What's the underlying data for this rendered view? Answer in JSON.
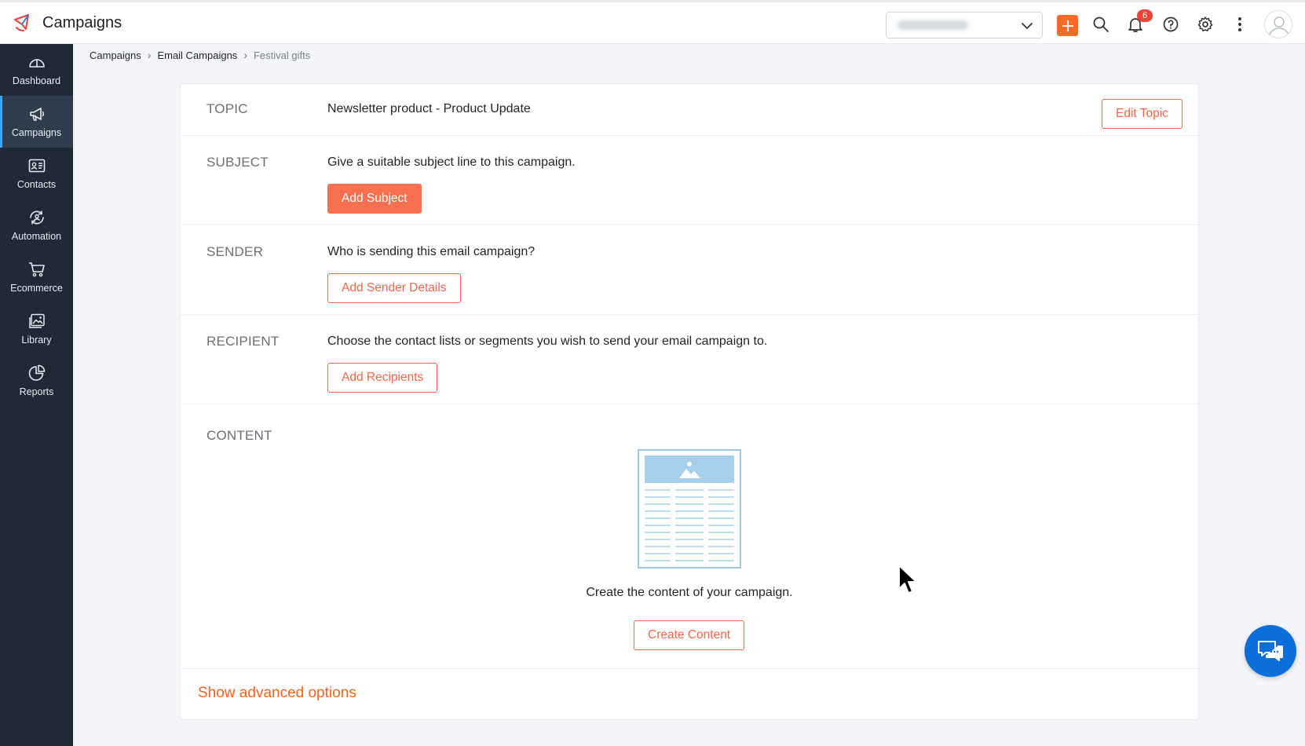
{
  "app": {
    "title": "Campaigns"
  },
  "topbar": {
    "notifications_count": "6",
    "icons": [
      "add-icon",
      "search-icon",
      "bell-icon",
      "help-icon",
      "gear-icon",
      "more-vertical-icon"
    ]
  },
  "sidebar": {
    "items": [
      {
        "label": "Dashboard",
        "icon": "dashboard-icon",
        "active": false
      },
      {
        "label": "Campaigns",
        "icon": "megaphone-icon",
        "active": true
      },
      {
        "label": "Contacts",
        "icon": "contact-card-icon",
        "active": false
      },
      {
        "label": "Automation",
        "icon": "automation-icon",
        "active": false
      },
      {
        "label": "Ecommerce",
        "icon": "cart-icon",
        "active": false
      },
      {
        "label": "Library",
        "icon": "image-library-icon",
        "active": false
      },
      {
        "label": "Reports",
        "icon": "pie-chart-icon",
        "active": false
      }
    ]
  },
  "breadcrumb": [
    "Campaigns",
    "Email Campaigns",
    "Festival gifts"
  ],
  "card": {
    "topic": {
      "label": "TOPIC",
      "value": "Newsletter product - Product Update",
      "edit_label": "Edit Topic"
    },
    "subject": {
      "label": "SUBJECT",
      "text": "Give a suitable subject line to this campaign.",
      "button": "Add Subject"
    },
    "sender": {
      "label": "SENDER",
      "text": "Who is sending this email campaign?",
      "button": "Add Sender Details"
    },
    "recipient": {
      "label": "RECIPIENT",
      "text": "Choose the contact lists or segments you wish to send your email campaign to.",
      "button": "Add Recipients"
    },
    "content": {
      "label": "CONTENT",
      "text": "Create the content of your campaign.",
      "button": "Create Content"
    },
    "advanced_link": "Show advanced options"
  },
  "colors": {
    "accent": "#f2654a",
    "accent_solid": "#f7704f",
    "link": "#f26322",
    "add_button": "#ff6a2b",
    "sidebar_bg": "#1f2a36",
    "sidebar_active": "#2f3d4c",
    "chat": "#0a6fd8"
  }
}
